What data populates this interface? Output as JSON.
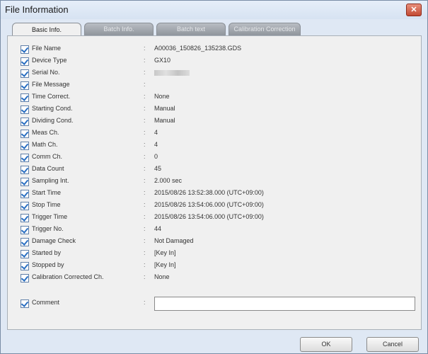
{
  "window": {
    "title": "File Information",
    "close_label": "✕"
  },
  "tabs": [
    {
      "label": "Basic Info.",
      "active": true
    },
    {
      "label": "Batch Info.",
      "active": false
    },
    {
      "label": "Batch text",
      "active": false
    },
    {
      "label": "Calibration Correction",
      "active": false
    }
  ],
  "fields": [
    {
      "label": "File Name",
      "value": "A00036_150826_135238.GDS",
      "checked": true
    },
    {
      "label": "Device Type",
      "value": "GX10",
      "checked": true
    },
    {
      "label": "Serial No.",
      "value": "",
      "checked": true,
      "redacted": true
    },
    {
      "label": "File Message",
      "value": "",
      "checked": true
    },
    {
      "label": "Time Correct.",
      "value": "None",
      "checked": true
    },
    {
      "label": "Starting Cond.",
      "value": "Manual",
      "checked": true
    },
    {
      "label": "Dividing Cond.",
      "value": "Manual",
      "checked": true
    },
    {
      "label": "Meas Ch.",
      "value": "4",
      "checked": true
    },
    {
      "label": "Math Ch.",
      "value": "4",
      "checked": true
    },
    {
      "label": "Comm Ch.",
      "value": "0",
      "checked": true
    },
    {
      "label": "Data Count",
      "value": "45",
      "checked": true
    },
    {
      "label": "Sampling Int.",
      "value": "2.000 sec",
      "checked": true
    },
    {
      "label": "Start Time",
      "value": "2015/08/26 13:52:38.000 (UTC+09:00)",
      "checked": true
    },
    {
      "label": "Stop Time",
      "value": "2015/08/26 13:54:06.000 (UTC+09:00)",
      "checked": true
    },
    {
      "label": "Trigger Time",
      "value": "2015/08/26 13:54:06.000 (UTC+09:00)",
      "checked": true
    },
    {
      "label": "Trigger No.",
      "value": "44",
      "checked": true
    },
    {
      "label": "Damage Check",
      "value": "Not Damaged",
      "checked": true
    },
    {
      "label": "Started by",
      "value": "[Key In]",
      "checked": true
    },
    {
      "label": "Stopped by",
      "value": "[Key In]",
      "checked": true
    },
    {
      "label": "Calibration Corrected Ch.",
      "value": "None",
      "checked": true
    }
  ],
  "comment": {
    "label": "Comment",
    "value": "",
    "checked": true
  },
  "colon": ":",
  "buttons": {
    "ok": "OK",
    "cancel": "Cancel"
  }
}
